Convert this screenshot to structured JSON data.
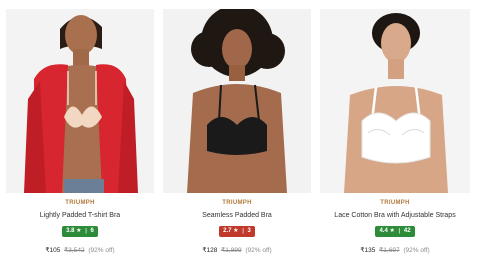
{
  "products": [
    {
      "brand": "TRIUMPH",
      "title": "Lightly Padded T-shirt Bra",
      "rating": "3.8",
      "rating_star": "★",
      "rating_count": "6",
      "rating_color": "#2e8b3a",
      "price": "₹105",
      "mrp": "₹3,542",
      "discount": "(92% off)",
      "photo_background": "#f3f3f3",
      "garment_color": "#f2d7c2",
      "jacket_color": "#d7262f"
    },
    {
      "brand": "TRIUMPH",
      "title": "Seamless Padded Bra",
      "rating": "2.7",
      "rating_star": "★",
      "rating_count": "3",
      "rating_color": "#c0392b",
      "price": "₹128",
      "mrp": "₹1,899",
      "discount": "(92% off)",
      "photo_background": "#f2f2f2",
      "garment_color": "#1a1a1a"
    },
    {
      "brand": "TRIUMPH",
      "title": "Lace Cotton Bra with Adjustable Straps",
      "rating": "4.4",
      "rating_star": "★",
      "rating_count": "42",
      "rating_color": "#2e8b3a",
      "price": "₹135",
      "mrp": "₹1,697",
      "discount": "(92% off)",
      "photo_background": "#f4f4f4",
      "garment_color": "#ffffff"
    }
  ]
}
